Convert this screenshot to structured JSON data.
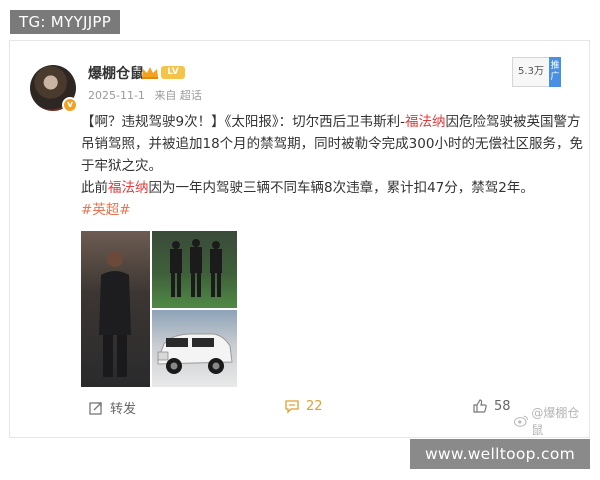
{
  "overlays": {
    "tg_label": "TG: MYYJJPP",
    "site_watermark": "www.welltoop.com"
  },
  "post": {
    "author": "爆棚仓鼠",
    "level": "LV",
    "date": "2025-11-1",
    "source": "来自 超话",
    "fans_count": "5.3万",
    "promo_label": "推广",
    "content": {
      "part1_pre": "【啊？违规驾驶9次！】《太阳报》：切尔西后卫韦斯利-",
      "part1_name": "福法纳",
      "part1_post": "因危险驾驶被英国警方吊销驾照，并被追加18个月的禁驾期，同时被勒令完成300小时的无偿社区服务，免于牢狱之灾。",
      "part2_pre": "此前",
      "part2_name": "福法纳",
      "part2_post": "因为一年内驾驶三辆不同车辆8次违章，累计扣47分，禁驾2年。",
      "hashtag": "#英超#"
    },
    "actions": {
      "repost_label": "转发",
      "comment_count": "22",
      "like_count": "58"
    },
    "watermark": "@爆棚仓鼠"
  },
  "colors": {
    "highlight_red": "#e4393c",
    "hashtag_orange": "#eb7350",
    "comment_gold": "#e0a02e"
  },
  "icons": [
    "avatar-verified-icon",
    "crown-icon",
    "repost-icon",
    "comment-icon",
    "like-icon",
    "weibo-logo-icon"
  ]
}
